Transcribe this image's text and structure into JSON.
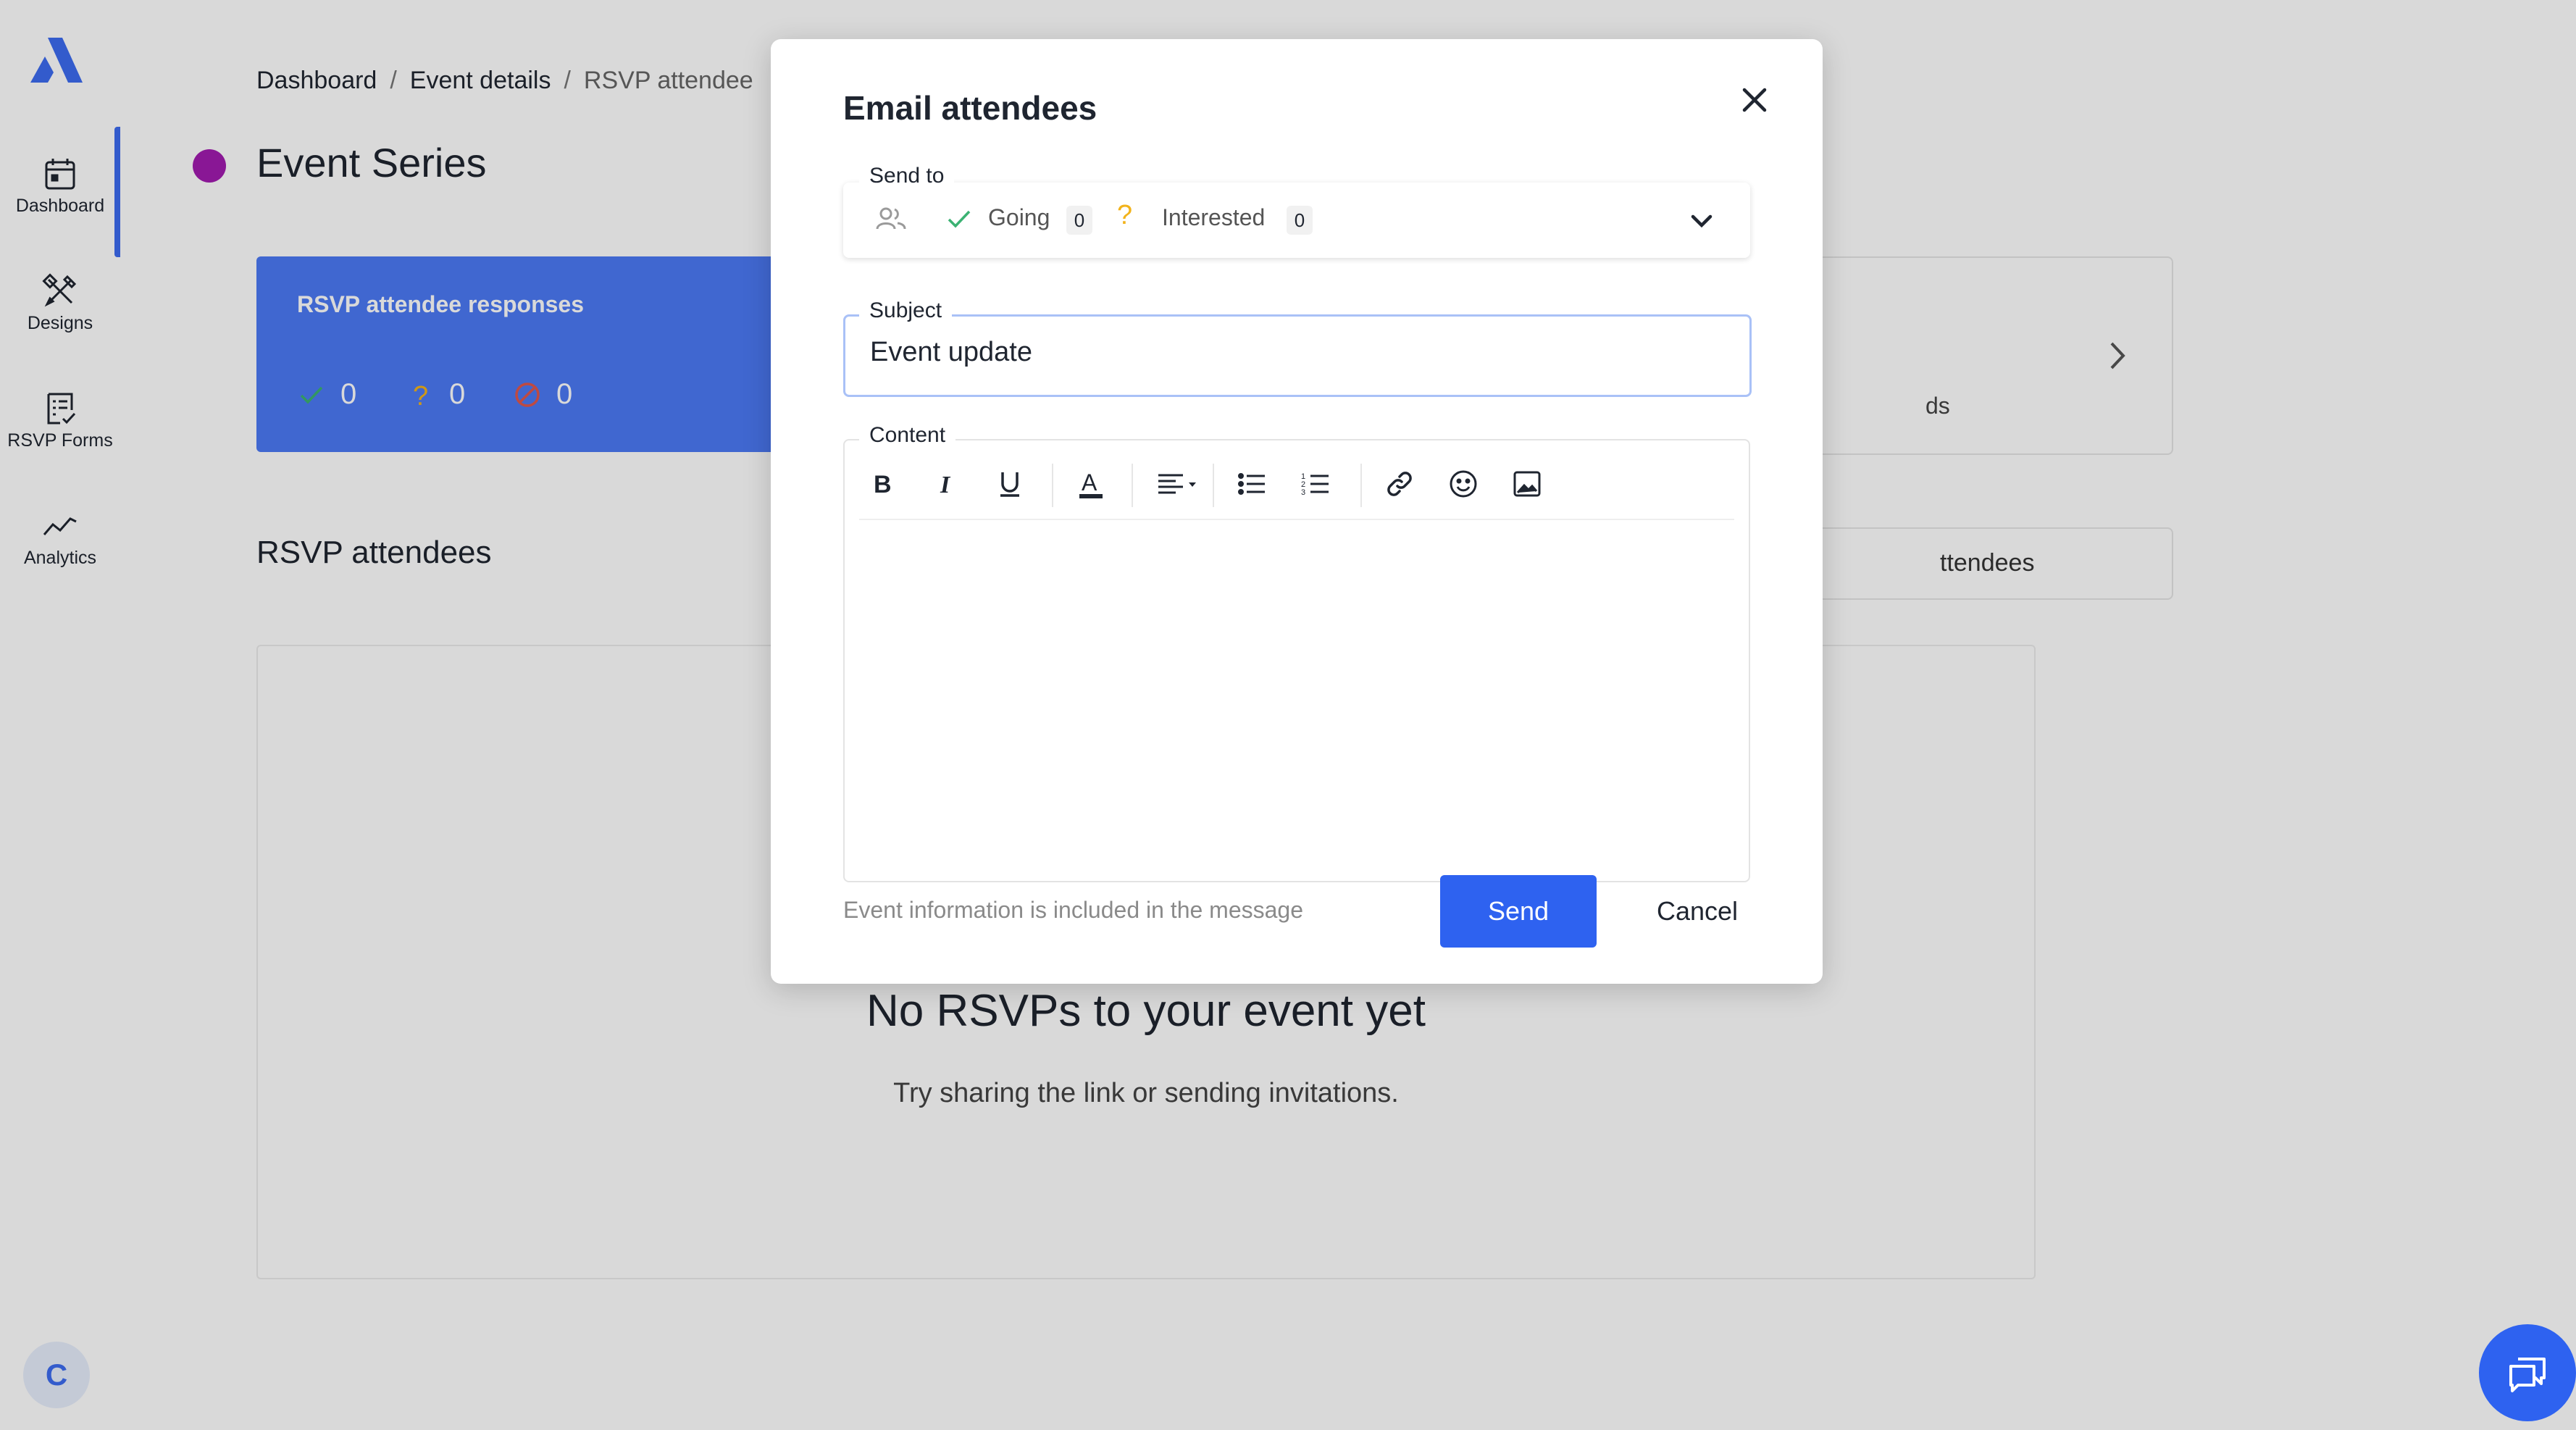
{
  "sidebar": {
    "logo": "brand-logo",
    "items": [
      {
        "label": "Dashboard",
        "icon": "calendar-icon",
        "active": true
      },
      {
        "label": "Designs",
        "icon": "designs-icon"
      },
      {
        "label": "RSVP Forms",
        "icon": "forms-icon"
      },
      {
        "label": "Analytics",
        "icon": "analytics-icon"
      }
    ],
    "avatar_initial": "C"
  },
  "breadcrumb": {
    "items": [
      "Dashboard",
      "Event details",
      "RSVP attendee"
    ],
    "separator": "/"
  },
  "page": {
    "title": "Event Series",
    "series_color": "#a21caf"
  },
  "responses_card": {
    "title": "RSVP attendee responses",
    "going_count": "0",
    "maybe_count": "0",
    "declined_count": "0",
    "color": "#4c79f5"
  },
  "right_card": {
    "fragment": "ds"
  },
  "attendees_section": {
    "title": "RSVP attendees",
    "button_fragment": "ttendees"
  },
  "empty_state": {
    "title": "No RSVPs to your event yet",
    "subtitle": "Try sharing the link or sending invitations."
  },
  "modal": {
    "title": "Email attendees",
    "send_to": {
      "label": "Send to",
      "going_label": "Going",
      "going_count": "0",
      "interested_label": "Interested",
      "interested_count": "0"
    },
    "subject": {
      "label": "Subject",
      "value": "Event update"
    },
    "content": {
      "label": "Content",
      "toolbar": [
        "bold",
        "italic",
        "underline",
        "text-color",
        "align",
        "bullet-list",
        "numbered-list",
        "link",
        "emoji",
        "image"
      ]
    },
    "footer_note": "Event information is included in the message",
    "send_label": "Send",
    "cancel_label": "Cancel"
  },
  "colors": {
    "accent": "#2e62f0",
    "going": "#3bb273",
    "interested": "#f2b31b",
    "declined": "#e0584e"
  }
}
